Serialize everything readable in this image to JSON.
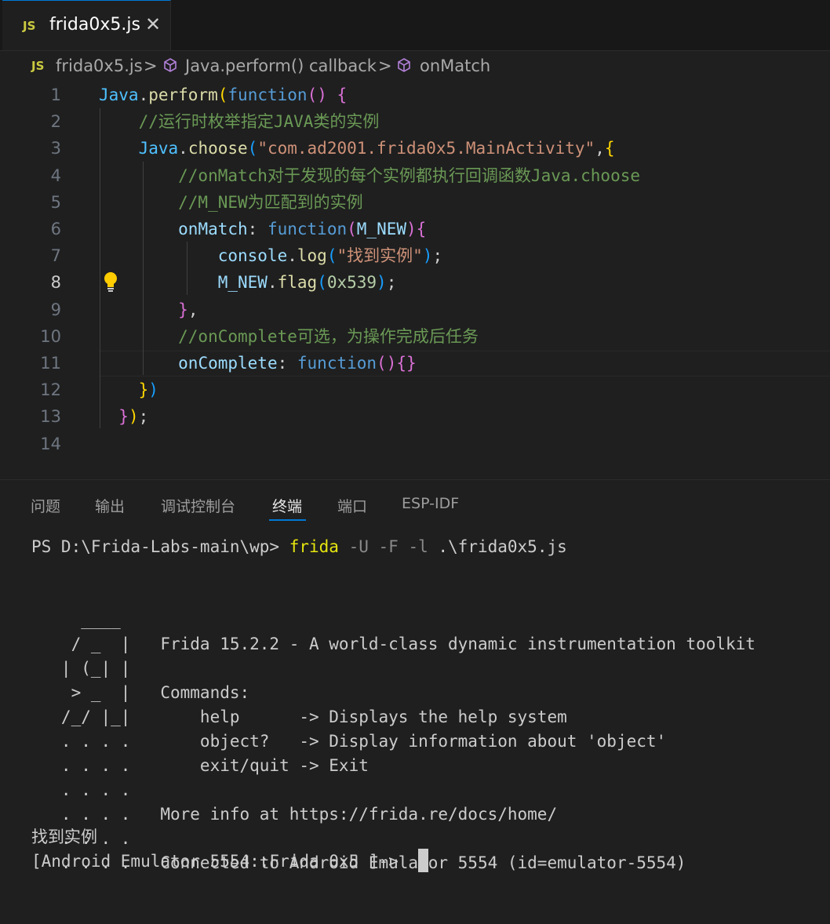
{
  "tab": {
    "badge": "JS",
    "label": "frida0x5.js",
    "close": "✕"
  },
  "breadcrumbs": {
    "badge": "JS",
    "items": [
      "frida0x5.js",
      "Java.perform() callback",
      "onMatch"
    ],
    "separator": ">"
  },
  "editor": {
    "line_numbers": [
      "1",
      "2",
      "3",
      "4",
      "5",
      "6",
      "7",
      "8",
      "9",
      "10",
      "11",
      "12",
      "13",
      "14"
    ],
    "active_line": "8",
    "lines": [
      [
        {
          "t": "Java",
          "c": "k-obj"
        },
        {
          "t": ".",
          "c": "k-txt"
        },
        {
          "t": "perform",
          "c": "k-fn"
        },
        {
          "t": "(",
          "c": "k-p1"
        },
        {
          "t": "function",
          "c": "k-kw"
        },
        {
          "t": "() ",
          "c": "k-p2"
        },
        {
          "t": "{",
          "c": "k-p2"
        }
      ],
      [
        {
          "t": "    //运行时枚举指定JAVA类的实例",
          "c": "k-com"
        }
      ],
      [
        {
          "t": "    ",
          "c": "k-txt"
        },
        {
          "t": "Java",
          "c": "k-obj"
        },
        {
          "t": ".",
          "c": "k-txt"
        },
        {
          "t": "choose",
          "c": "k-fn"
        },
        {
          "t": "(",
          "c": "k-p3"
        },
        {
          "t": "\"com.ad2001.frida0x5.MainActivity\"",
          "c": "k-str"
        },
        {
          "t": ",",
          "c": "k-txt"
        },
        {
          "t": "{",
          "c": "k-p1"
        }
      ],
      [
        {
          "t": "        //onMatch对于发现的每个实例都执行回调函数Java.choose",
          "c": "k-com"
        }
      ],
      [
        {
          "t": "        //M_NEW为匹配到的实例",
          "c": "k-com"
        }
      ],
      [
        {
          "t": "        ",
          "c": "k-txt"
        },
        {
          "t": "onMatch",
          "c": "k-var"
        },
        {
          "t": ": ",
          "c": "k-txt"
        },
        {
          "t": "function",
          "c": "k-kw"
        },
        {
          "t": "(",
          "c": "k-p2"
        },
        {
          "t": "M_NEW",
          "c": "k-var"
        },
        {
          "t": ")",
          "c": "k-p2"
        },
        {
          "t": "{",
          "c": "k-p2"
        }
      ],
      [
        {
          "t": "            ",
          "c": "k-txt"
        },
        {
          "t": "console",
          "c": "k-var"
        },
        {
          "t": ".",
          "c": "k-txt"
        },
        {
          "t": "log",
          "c": "k-fn"
        },
        {
          "t": "(",
          "c": "k-p3"
        },
        {
          "t": "\"找到实例\"",
          "c": "k-str"
        },
        {
          "t": ")",
          "c": "k-p3"
        },
        {
          "t": ";",
          "c": "k-txt"
        }
      ],
      [
        {
          "t": "            ",
          "c": "k-txt"
        },
        {
          "t": "M_NEW",
          "c": "k-var"
        },
        {
          "t": ".",
          "c": "k-txt"
        },
        {
          "t": "flag",
          "c": "k-fn"
        },
        {
          "t": "(",
          "c": "k-p3"
        },
        {
          "t": "0x539",
          "c": "k-num"
        },
        {
          "t": ")",
          "c": "k-p3"
        },
        {
          "t": ";",
          "c": "k-txt"
        }
      ],
      [
        {
          "t": "        ",
          "c": "k-txt"
        },
        {
          "t": "}",
          "c": "k-p2"
        },
        {
          "t": ",",
          "c": "k-txt"
        }
      ],
      [
        {
          "t": "        //onComplete可选，为操作完成后任务",
          "c": "k-com"
        }
      ],
      [
        {
          "t": "        ",
          "c": "k-txt"
        },
        {
          "t": "onComplete",
          "c": "k-var"
        },
        {
          "t": ": ",
          "c": "k-txt"
        },
        {
          "t": "function",
          "c": "k-kw"
        },
        {
          "t": "()",
          "c": "k-p2"
        },
        {
          "t": "{}",
          "c": "k-p2"
        }
      ],
      [
        {
          "t": "    ",
          "c": "k-txt"
        },
        {
          "t": "}",
          "c": "k-p1"
        },
        {
          "t": ")",
          "c": "k-p3"
        }
      ],
      [
        {
          "t": "  ",
          "c": "k-txt"
        },
        {
          "t": "}",
          "c": "k-p2"
        },
        {
          "t": ")",
          "c": "k-p1"
        },
        {
          "t": ";",
          "c": "k-txt"
        }
      ],
      []
    ]
  },
  "panel": {
    "tabs": [
      "问题",
      "输出",
      "调试控制台",
      "终端",
      "端口",
      "ESP-IDF"
    ],
    "active_tab": "终端"
  },
  "terminal": {
    "prompt": "PS D:\\Frida-Labs-main\\wp> ",
    "cmd": "frida",
    "flags": " -U -F -l",
    "arg": " .\\frida0x5.js",
    "banner": [
      "     ____",
      "    / _  |   Frida 15.2.2 - A world-class dynamic instrumentation toolkit",
      "   | (_| |",
      "    > _  |   Commands:",
      "   /_/ |_|       help      -> Displays the help system",
      "   . . . .       object?   -> Display information about 'object'",
      "   . . . .       exit/quit -> Exit",
      "   . . . .",
      "   . . . .   More info at https://frida.re/docs/home/",
      "   . . . .",
      "   . . . .   Connected to Android Emulator 5554 (id=emulator-5554)"
    ],
    "output": "找到实例",
    "repl_prompt": "[Android Emulator 5554::Frida 0x5 ]-> "
  }
}
